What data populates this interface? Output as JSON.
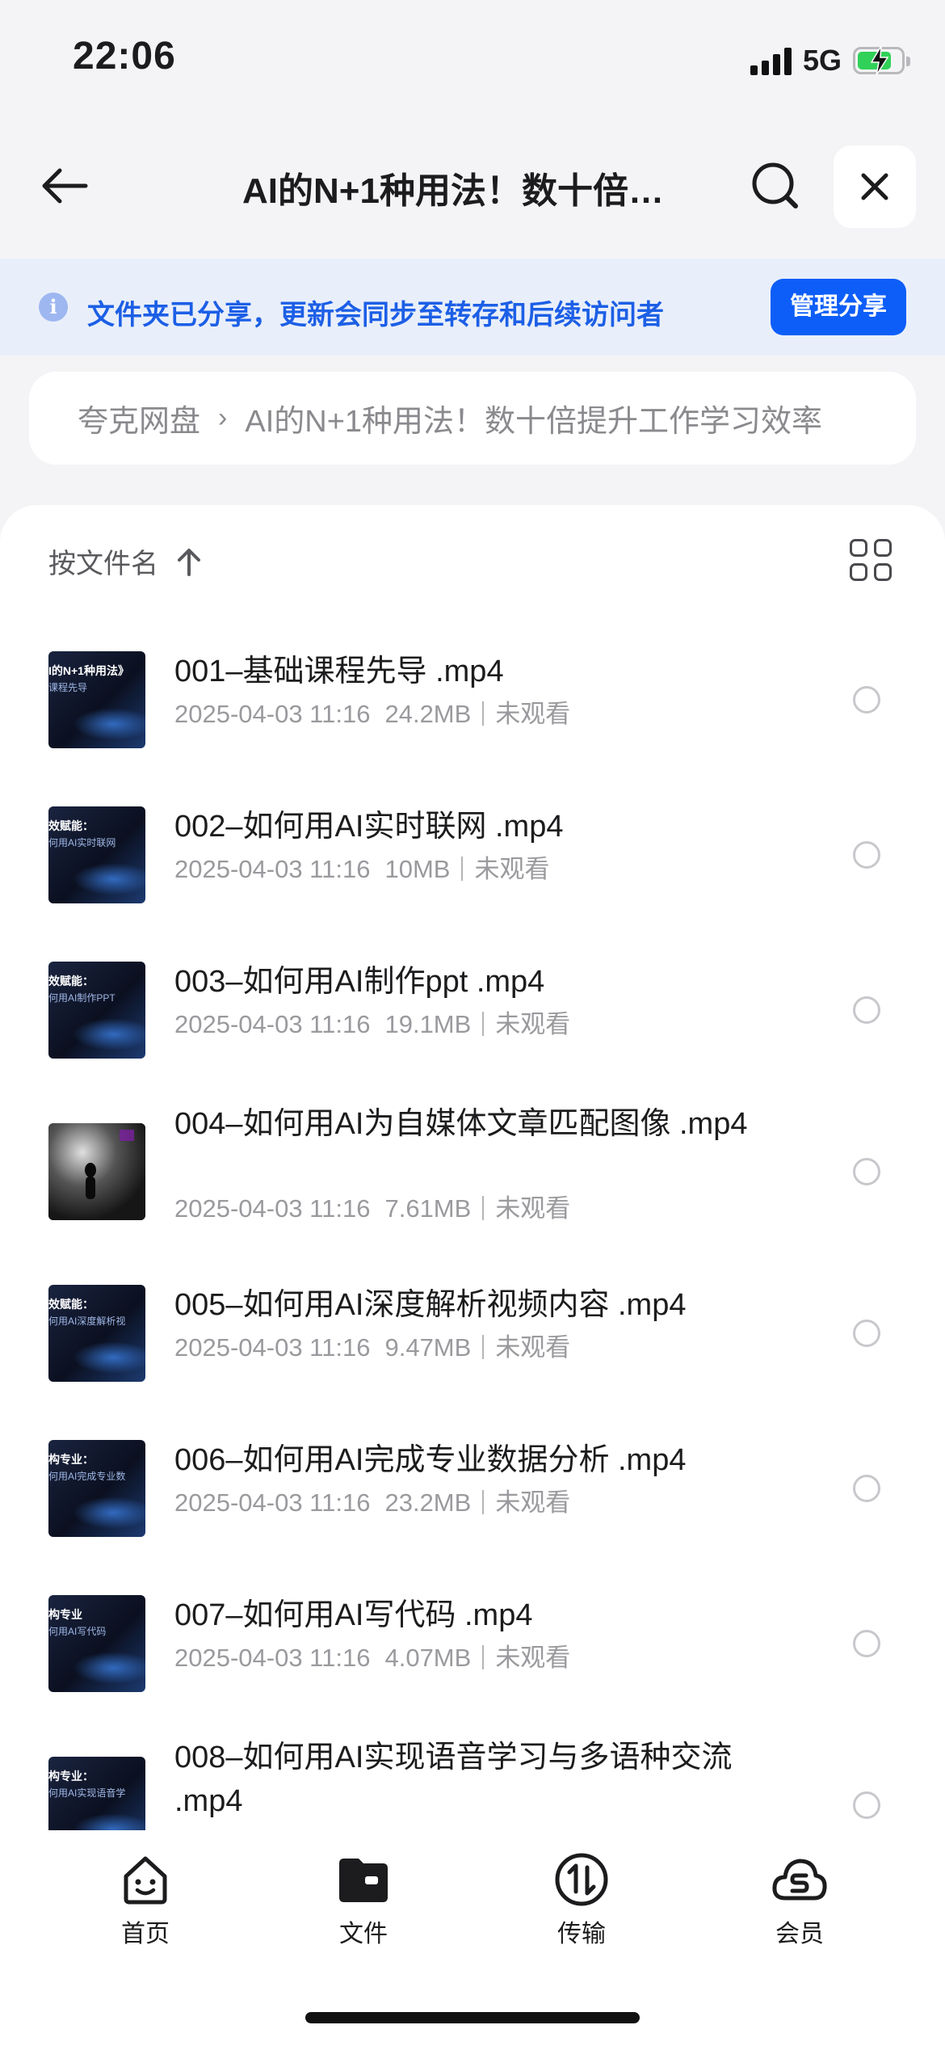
{
  "status_bar": {
    "time": "22:06",
    "network": "5G"
  },
  "nav": {
    "title": "AI的N+1种用法！数十倍提升工作学习效率"
  },
  "share_banner": {
    "text": "文件夹已分享，更新会同步至转存和后续访问者",
    "manage_label": "管理分享"
  },
  "breadcrumb": {
    "items": [
      "夸克网盘",
      "AI的N+1种用法！数十倍提升工作学习效率"
    ]
  },
  "list_header": {
    "sort_label": "按文件名"
  },
  "files": [
    {
      "name": "001–基础课程先导 .mp4",
      "date": "2025-04-03 11:16",
      "size": "24.2MB",
      "status": "未观看",
      "thumb_line1": "I的N+1种用法》",
      "thumb_line2": "课程先导"
    },
    {
      "name": "002–如何用AI实时联网 .mp4",
      "date": "2025-04-03 11:16",
      "size": "10MB",
      "status": "未观看",
      "thumb_line1": "效赋能：",
      "thumb_line2": "何用AI实时联网"
    },
    {
      "name": "003–如何用AI制作ppt .mp4",
      "date": "2025-04-03 11:16",
      "size": "19.1MB",
      "status": "未观看",
      "thumb_line1": "效赋能：",
      "thumb_line2": "何用AI制作PPT"
    },
    {
      "name": "004–如何用AI为自媒体文章匹配图像 .mp4",
      "date": "2025-04-03 11:16",
      "size": "7.61MB",
      "status": "未观看",
      "thumb_line1": "",
      "thumb_line2": ""
    },
    {
      "name": "005–如何用AI深度解析视频内容 .mp4",
      "date": "2025-04-03 11:16",
      "size": "9.47MB",
      "status": "未观看",
      "thumb_line1": "效赋能：",
      "thumb_line2": "何用AI深度解析视"
    },
    {
      "name": "006–如何用AI完成专业数据分析 .mp4",
      "date": "2025-04-03 11:16",
      "size": "23.2MB",
      "status": "未观看",
      "thumb_line1": "构专业：",
      "thumb_line2": "何用AI完成专业数"
    },
    {
      "name": "007–如何用AI写代码 .mp4",
      "date": "2025-04-03 11:16",
      "size": "4.07MB",
      "status": "未观看",
      "thumb_line1": "构专业",
      "thumb_line2": "何用AI写代码"
    },
    {
      "name": "008–如何用AI实现语音学习与多语种交流 .mp4",
      "date": "",
      "size": "",
      "status": "",
      "thumb_line1": "构专业：",
      "thumb_line2": "何用AI实现语音学"
    }
  ],
  "tabs": [
    {
      "label": "首页",
      "icon": "home-face-icon"
    },
    {
      "label": "文件",
      "icon": "folder-icon"
    },
    {
      "label": "传输",
      "icon": "transfer-icon"
    },
    {
      "label": "会员",
      "icon": "member-cloud-icon"
    }
  ],
  "colors": {
    "accent": "#0d5ef8",
    "banner_bg": "#e9effa",
    "banner_text": "#1c5fe6",
    "battery": "#30d158"
  }
}
